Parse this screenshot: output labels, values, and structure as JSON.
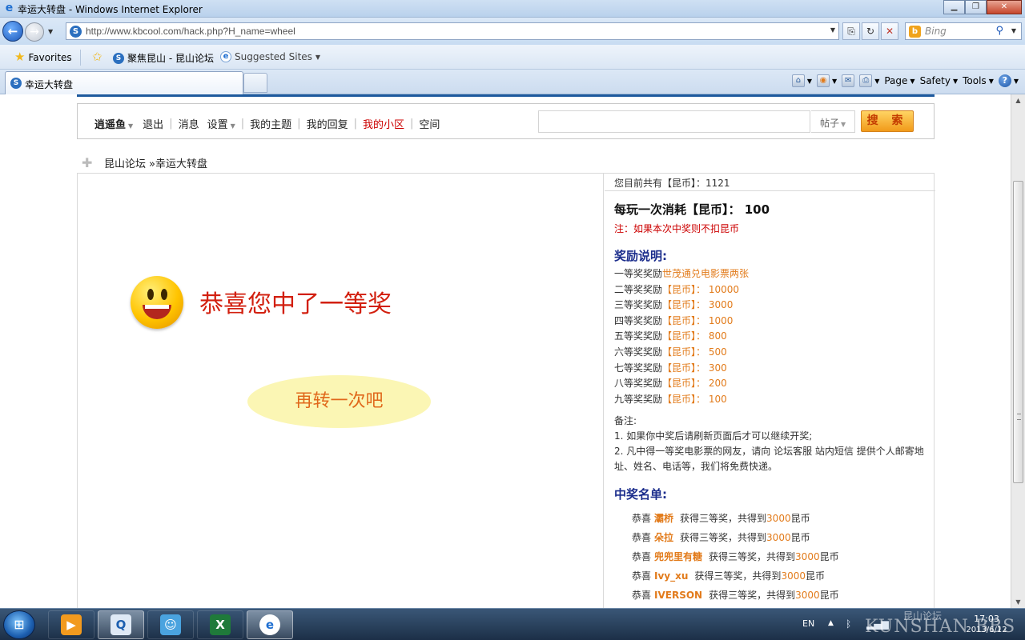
{
  "window": {
    "title": "幸运大转盘 - Windows Internet Explorer",
    "url": "http://www.kbcool.com/hack.php?H_name=wheel",
    "search_placeholder": "Bing"
  },
  "favorites_bar": {
    "favorites_label": "Favorites",
    "link1": "聚焦昆山 - 昆山论坛",
    "link2": "Suggested Sites"
  },
  "tab": {
    "label": "幸运大转盘"
  },
  "command_bar": {
    "page": "Page",
    "safety": "Safety",
    "tools": "Tools"
  },
  "user_bar": {
    "username": "逍遥鱼",
    "logout": "退出",
    "messages": "消息",
    "settings": "设置",
    "my_topics": "我的主题",
    "my_replies": "我的回复",
    "my_district": "我的小区",
    "space": "空间",
    "search_type": "帖子",
    "search_button": "搜 索"
  },
  "breadcrumb": {
    "home": "昆山论坛",
    "current": "»幸运大转盘"
  },
  "result": {
    "message": "恭喜您中了一等奖",
    "spin_again": "再转一次吧"
  },
  "sidebar": {
    "coins_text": "您目前共有【昆币】：1121",
    "cost_text": "每玩一次消耗【昆币】： 100",
    "note": "注：如果本次中奖则不扣昆币",
    "rewards_title": "奖励说明:",
    "prizes": [
      {
        "rank": "一等奖奖励",
        "reward": "世茂通兑电影票两张",
        "amount": ""
      },
      {
        "rank": "二等奖奖励",
        "reward": "【昆币】：",
        "amount": "10000"
      },
      {
        "rank": "三等奖奖励",
        "reward": "【昆币】：",
        "amount": "3000"
      },
      {
        "rank": "四等奖奖励",
        "reward": "【昆币】：",
        "amount": "1000"
      },
      {
        "rank": "五等奖奖励",
        "reward": "【昆币】：",
        "amount": "800"
      },
      {
        "rank": "六等奖奖励",
        "reward": "【昆币】：",
        "amount": "500"
      },
      {
        "rank": "七等奖奖励",
        "reward": "【昆币】：",
        "amount": "300"
      },
      {
        "rank": "八等奖奖励",
        "reward": "【昆币】：",
        "amount": "200"
      },
      {
        "rank": "九等奖奖励",
        "reward": "【昆币】：",
        "amount": "100"
      }
    ],
    "remarks_label": "备注:",
    "remark1": "1. 如果你中奖后请刷新页面后才可以继续开奖;",
    "remark2": "2. 凡中得一等奖电影票的网友，请向 论坛客服 站内短信 提供个人邮寄地址、姓名、电话等，我们将免费快递。",
    "winners_title": "中奖名单:",
    "winners": [
      {
        "prefix": "恭喜",
        "name": "灞桥",
        "prize": "获得三等奖，共得到",
        "amount": "3000",
        "unit": "昆币"
      },
      {
        "prefix": "恭喜",
        "name": "朵拉",
        "prize": "获得三等奖，共得到",
        "amount": "3000",
        "unit": "昆币"
      },
      {
        "prefix": "恭喜",
        "name": "兜兜里有糖",
        "prize": "获得三等奖，共得到",
        "amount": "3000",
        "unit": "昆币"
      },
      {
        "prefix": "恭喜",
        "name": "Ivy_xu",
        "prize": "获得三等奖，共得到",
        "amount": "3000",
        "unit": "昆币"
      },
      {
        "prefix": "恭喜",
        "name": "IVERSON",
        "prize": "获得三等奖，共得到",
        "amount": "3000",
        "unit": "昆币"
      }
    ]
  },
  "taskbar": {
    "language": "EN",
    "time": "17:03",
    "date": "2013/6/12",
    "watermark_cn": "昆山论坛",
    "watermark_en": "KUNSHAN BBS"
  }
}
